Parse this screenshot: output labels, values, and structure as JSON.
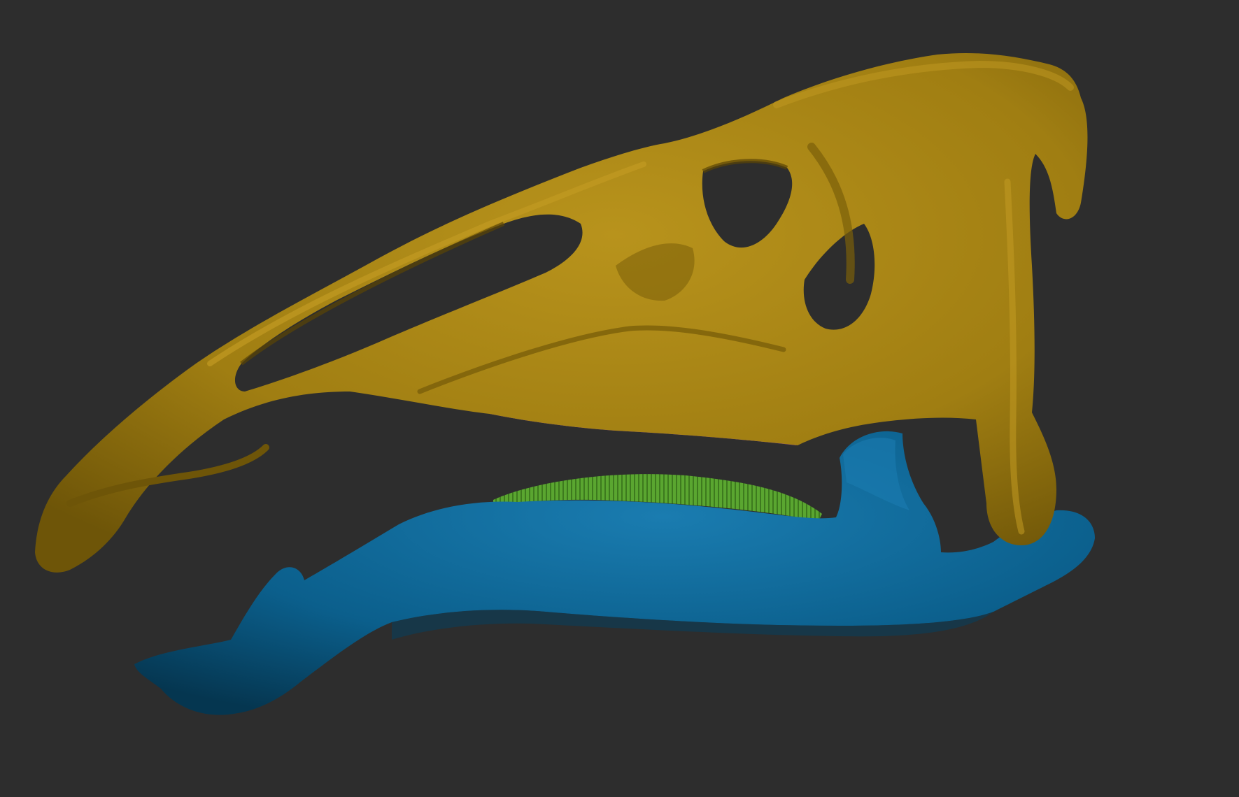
{
  "scene": {
    "subject": "skull-model-lateral-view",
    "background_color": "#2d2d2d",
    "parts": [
      {
        "id": "cranium",
        "color": "#a07e12",
        "shade": "#7a5f0a",
        "highlight": "#c29a22"
      },
      {
        "id": "upper-tooth-row",
        "color": "#8a2fd0"
      },
      {
        "id": "lower-tooth-row",
        "color": "#5aa630"
      },
      {
        "id": "mandible",
        "color": "#0b5f8c",
        "shade": "#07405f",
        "highlight": "#1a7cb0"
      }
    ]
  }
}
